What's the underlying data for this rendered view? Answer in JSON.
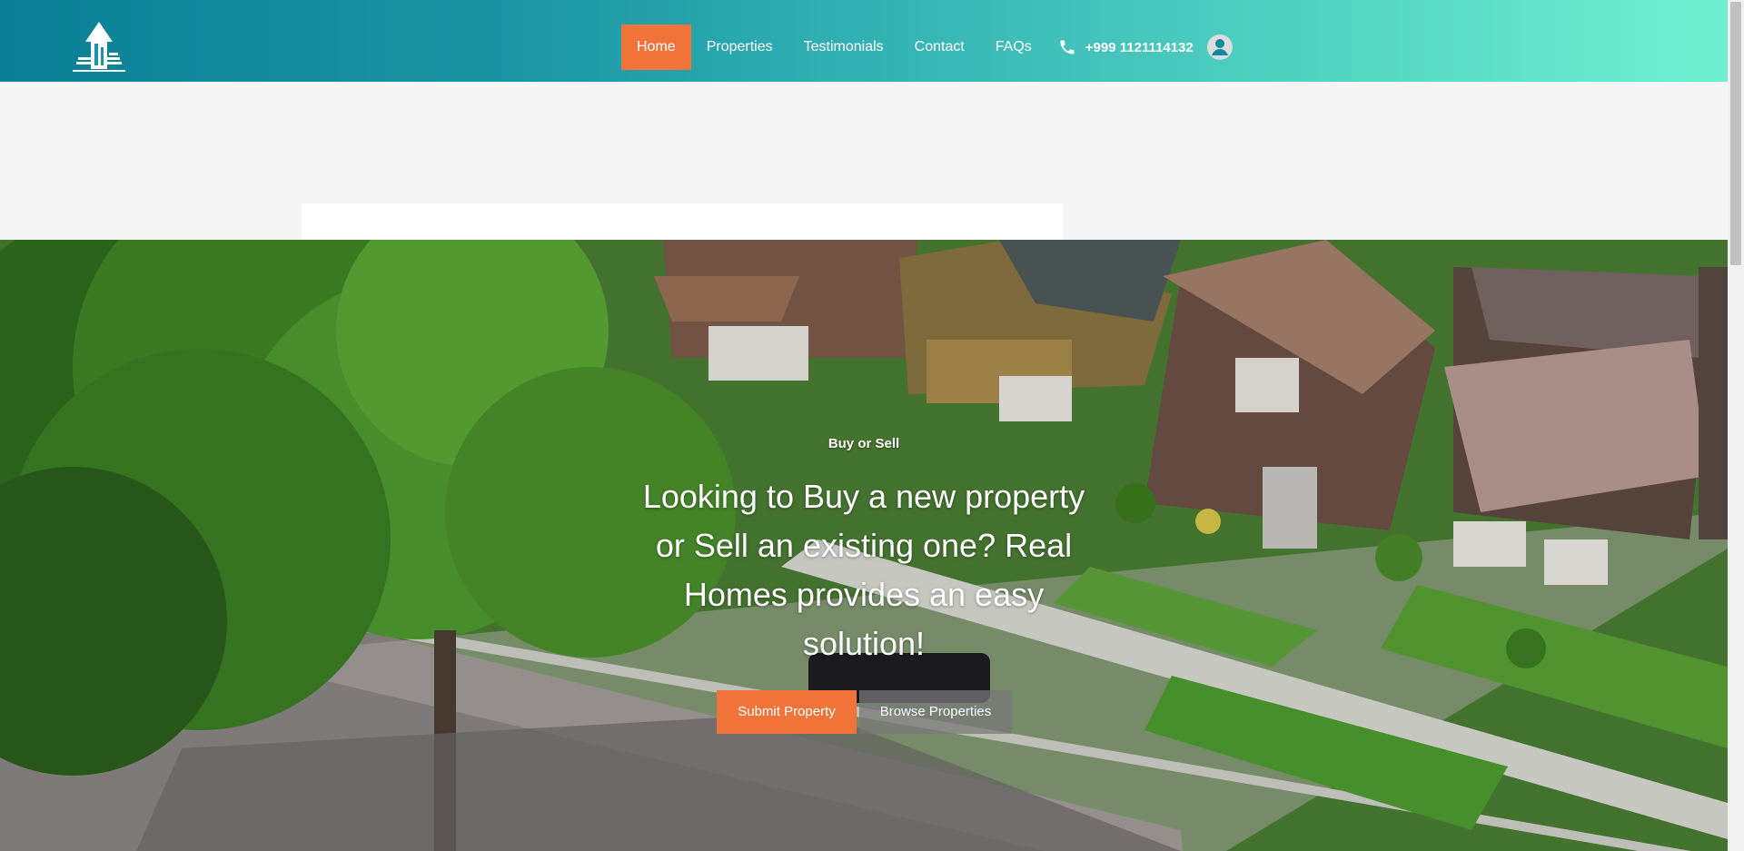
{
  "header": {
    "logo_icon": "house-arrow-logo",
    "nav": [
      {
        "label": "Home",
        "active": true
      },
      {
        "label": "Properties",
        "active": false
      },
      {
        "label": "Testimonials",
        "active": false
      },
      {
        "label": "Contact",
        "active": false
      },
      {
        "label": "FAQs",
        "active": false
      }
    ],
    "phone": "+999 1121114132",
    "phone_icon": "phone-icon",
    "user_icon": "user-account-icon"
  },
  "hero": {
    "eyebrow": "Buy or Sell",
    "headline": "Looking to Buy a new property or Sell an existing one? Real Homes provides an easy solution!",
    "primary_button": "Submit Property",
    "secondary_button": "Browse Properties"
  },
  "colors": {
    "accent": "#f0733a",
    "header_start": "#0a7f95",
    "header_end": "#6ff0d0"
  }
}
